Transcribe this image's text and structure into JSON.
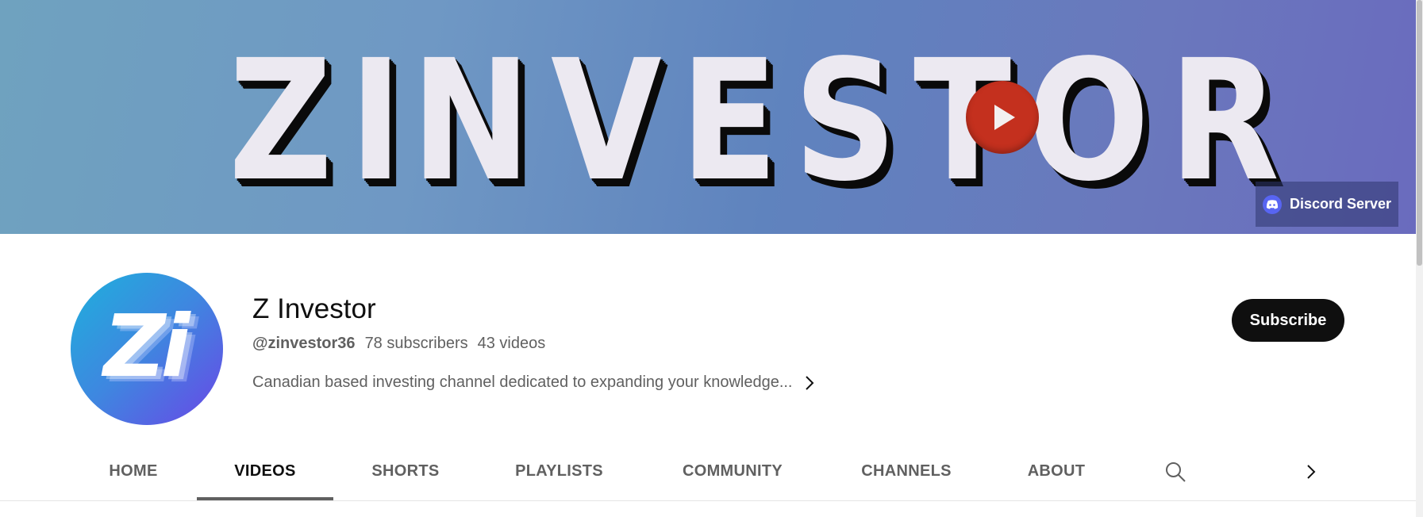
{
  "banner": {
    "title_letters": [
      "Z",
      "I",
      "N",
      "V",
      "E",
      "S",
      "T",
      "O",
      "R"
    ],
    "play_icon": "play-icon",
    "discord_button": {
      "label": "Discord Server",
      "icon": "discord-icon",
      "color": "#5865f2"
    }
  },
  "channel": {
    "avatar_text": "Zi",
    "name": "Z Investor",
    "handle": "@zinvestor36",
    "subscribers": "78 subscribers",
    "videos": "43 videos",
    "description": "Canadian based investing channel dedicated to expanding your knowledge...",
    "subscribe_label": "Subscribe"
  },
  "tabs": {
    "items": [
      {
        "label": "HOME",
        "active": false
      },
      {
        "label": "VIDEOS",
        "active": true
      },
      {
        "label": "SHORTS",
        "active": false
      },
      {
        "label": "PLAYLISTS",
        "active": false
      },
      {
        "label": "COMMUNITY",
        "active": false
      },
      {
        "label": "CHANNELS",
        "active": false
      },
      {
        "label": "ABOUT",
        "active": false
      }
    ],
    "search_icon": "search-icon",
    "next_icon": "chevron-right-icon"
  },
  "colors": {
    "accent_dark": "#0f0f0f",
    "secondary_text": "#606060",
    "play_red": "#c4301e"
  }
}
